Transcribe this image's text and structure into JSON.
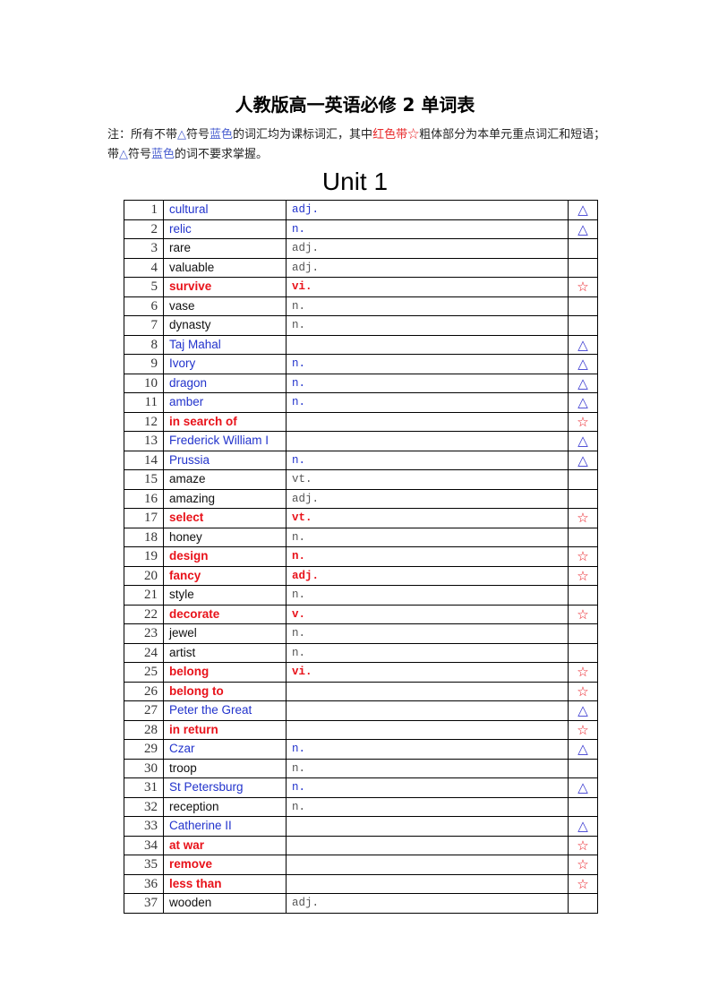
{
  "document": {
    "title": "人教版高一英语必修 2 单词表",
    "note": {
      "parts": [
        {
          "text": "注：所有不带",
          "style": "normal"
        },
        {
          "text": "△",
          "style": "blue"
        },
        {
          "text": "符号",
          "style": "normal"
        },
        {
          "text": "蓝色",
          "style": "blue"
        },
        {
          "text": "的词汇均为课标词汇，其中",
          "style": "normal"
        },
        {
          "text": "红色带",
          "style": "red"
        },
        {
          "text": "☆",
          "style": "red"
        },
        {
          "text": "粗体部分为本单元重点词汇和短语；带",
          "style": "normal"
        },
        {
          "text": "△",
          "style": "blue"
        },
        {
          "text": "符号",
          "style": "normal"
        },
        {
          "text": "蓝色",
          "style": "blue"
        },
        {
          "text": "的词不要求掌握。",
          "style": "normal"
        }
      ]
    },
    "unit_heading": "Unit 1",
    "colors": {
      "blue": "#2233cc",
      "red": "#e8121a"
    },
    "mark_symbols": {
      "triangle": "△",
      "star": "☆"
    },
    "rows": [
      {
        "num": "1",
        "word": "cultural",
        "pos": "adj.",
        "type": "blue",
        "mark": "triangle"
      },
      {
        "num": "2",
        "word": "relic",
        "pos": "n.",
        "type": "blue",
        "mark": "triangle"
      },
      {
        "num": "3",
        "word": "rare",
        "pos": "adj.",
        "type": "normal",
        "mark": ""
      },
      {
        "num": "4",
        "word": "valuable",
        "pos": "adj.",
        "type": "normal",
        "mark": ""
      },
      {
        "num": "5",
        "word": "survive",
        "pos": "vi.",
        "type": "red",
        "mark": "star"
      },
      {
        "num": "6",
        "word": "vase",
        "pos": "n.",
        "type": "normal",
        "mark": ""
      },
      {
        "num": "7",
        "word": "dynasty",
        "pos": "n.",
        "type": "normal",
        "mark": ""
      },
      {
        "num": "8",
        "word": "Taj Mahal",
        "pos": "",
        "type": "blue",
        "mark": "triangle"
      },
      {
        "num": "9",
        "word": "Ivory",
        "pos": "n.",
        "type": "blue",
        "mark": "triangle"
      },
      {
        "num": "10",
        "word": "dragon",
        "pos": "n.",
        "type": "blue",
        "mark": "triangle"
      },
      {
        "num": "11",
        "word": "amber",
        "pos": "n.",
        "type": "blue",
        "mark": "triangle"
      },
      {
        "num": "12",
        "word": "in search of",
        "pos": "",
        "type": "red",
        "mark": "star"
      },
      {
        "num": "13",
        "word": "Frederick William I",
        "pos": "",
        "type": "blue",
        "mark": "triangle"
      },
      {
        "num": "14",
        "word": "Prussia",
        "pos": "n.",
        "type": "blue",
        "mark": "triangle"
      },
      {
        "num": "15",
        "word": "amaze",
        "pos": "vt.",
        "type": "normal",
        "mark": ""
      },
      {
        "num": "16",
        "word": "amazing",
        "pos": "adj.",
        "type": "normal",
        "mark": ""
      },
      {
        "num": "17",
        "word": "select",
        "pos": "vt.",
        "type": "red",
        "mark": "star"
      },
      {
        "num": "18",
        "word": "honey",
        "pos": "n.",
        "type": "normal",
        "mark": ""
      },
      {
        "num": "19",
        "word": "design",
        "pos": "n.",
        "type": "red",
        "mark": "star"
      },
      {
        "num": "20",
        "word": "fancy",
        "pos": "adj.",
        "type": "red",
        "mark": "star"
      },
      {
        "num": "21",
        "word": "style",
        "pos": "n.",
        "type": "normal",
        "mark": ""
      },
      {
        "num": "22",
        "word": "decorate",
        "pos": "v.",
        "type": "red",
        "mark": "star"
      },
      {
        "num": "23",
        "word": "jewel",
        "pos": "n.",
        "type": "normal",
        "mark": ""
      },
      {
        "num": "24",
        "word": "artist",
        "pos": "n.",
        "type": "normal",
        "mark": ""
      },
      {
        "num": "25",
        "word": "belong",
        "pos": "vi.",
        "type": "red",
        "mark": "star"
      },
      {
        "num": "26",
        "word": "belong to",
        "pos": "",
        "type": "red",
        "mark": "star"
      },
      {
        "num": "27",
        "word": "Peter the Great",
        "pos": "",
        "type": "blue",
        "mark": "triangle"
      },
      {
        "num": "28",
        "word": "in return",
        "pos": "",
        "type": "red",
        "mark": "star"
      },
      {
        "num": "29",
        "word": "Czar",
        "pos": "n.",
        "type": "blue",
        "mark": "triangle"
      },
      {
        "num": "30",
        "word": "troop",
        "pos": "n.",
        "type": "normal",
        "mark": ""
      },
      {
        "num": "31",
        "word": "St Petersburg",
        "pos": "n.",
        "type": "blue",
        "mark": "triangle"
      },
      {
        "num": "32",
        "word": "reception",
        "pos": "n.",
        "type": "normal",
        "mark": ""
      },
      {
        "num": "33",
        "word": "Catherine II",
        "pos": "",
        "type": "blue",
        "mark": "triangle"
      },
      {
        "num": "34",
        "word": "at war",
        "pos": "",
        "type": "red",
        "mark": "star"
      },
      {
        "num": "35",
        "word": "remove",
        "pos": "",
        "type": "red",
        "mark": "star"
      },
      {
        "num": "36",
        "word": "less than",
        "pos": "",
        "type": "red",
        "mark": "star"
      },
      {
        "num": "37",
        "word": "wooden",
        "pos": "adj.",
        "type": "normal",
        "mark": ""
      }
    ]
  }
}
